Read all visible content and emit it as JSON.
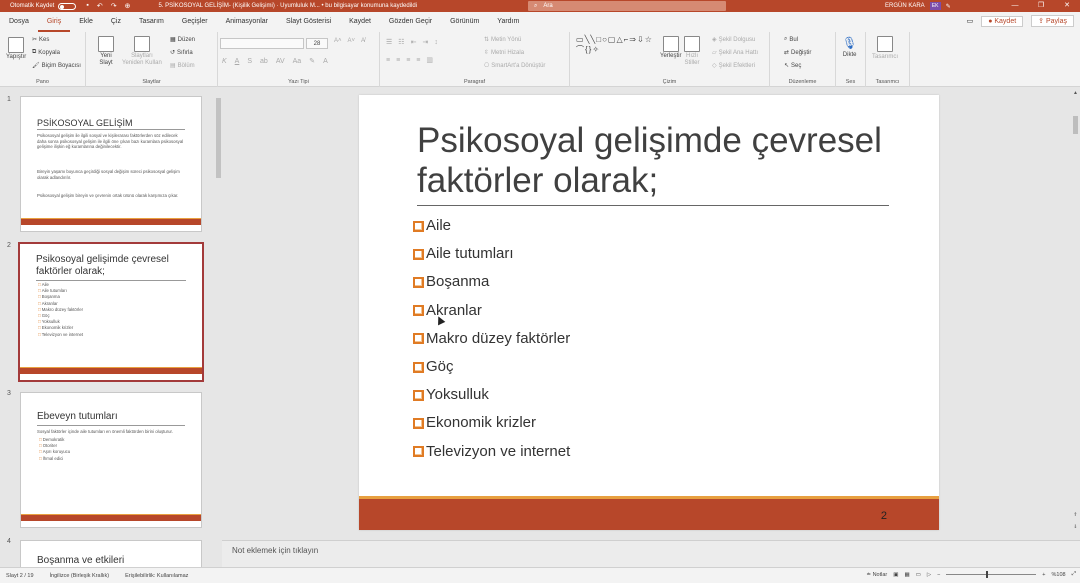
{
  "titlebar": {
    "autosave_label": "Otomatik Kaydet",
    "doc_title": "5. PSİKOSOYAL GELİŞİM- (Kişilik Gelişimi) · Uyumluluk M... • bu bilgisayar konumuna kaydedildi",
    "search_placeholder": "Ara",
    "user_name": "ERGÜN KARA",
    "user_initials": "EK",
    "qa_undo": "↶",
    "qa_redo": "↷",
    "qa_start": "⊕"
  },
  "menu": {
    "tabs": [
      "Dosya",
      "Giriş",
      "Ekle",
      "Çiz",
      "Tasarım",
      "Geçişler",
      "Animasyonlar",
      "Slayt Gösterisi",
      "Kaydet",
      "Gözden Geçir",
      "Görünüm",
      "Yardım"
    ],
    "active_tab": "Giriş",
    "record_btn": "Kaydet",
    "share_btn": "Paylaş"
  },
  "ribbon": {
    "pano": {
      "name": "Pano",
      "paste": "Yapıştır",
      "cut": "Kes",
      "copy": "Kopyala",
      "format_painter": "Biçim Boyacısı"
    },
    "slaytlar": {
      "name": "Slaytlar",
      "new_slide": "Yeni",
      "new_slide2": "Slayt",
      "reuse": "Slaytları",
      "reuse2": "Yeniden Kullan",
      "layout": "Düzen",
      "reset": "Sıfırla",
      "section": "Bölüm"
    },
    "yazi_tipi": {
      "name": "Yazı Tipi",
      "size": "28"
    },
    "paragraf": {
      "name": "Paragraf",
      "text_dir": "Metin Yönü",
      "align_text": "Metni Hizala",
      "smartart": "SmartArt'a Dönüştür"
    },
    "cizim": {
      "name": "Çizim",
      "arrange": "Yerleştir",
      "quick_styles": "Hızlı",
      "quick_styles2": "Stiller",
      "fill": "Şekil Dolgusu",
      "outline": "Şekil Ana Hattı",
      "effects": "Şekil Efektleri"
    },
    "duzenleme": {
      "name": "Düzenleme",
      "find": "Bul",
      "replace": "Değiştir",
      "select": "Seç"
    },
    "ses": {
      "name": "Ses",
      "dictate": "Dikte"
    },
    "tasarimci": {
      "name": "Tasarımcı",
      "label": "Tasarımcı"
    }
  },
  "thumbnails": [
    {
      "num": "1",
      "title": "PSİKOSOYAL GELİŞİM",
      "para1": "Psikososyal gelişim ile ilgili sosyal ve kişilerarası faktörlerden söz edilecek daha sonra psikososyal gelişim ile ilgili öne çıkan bazı kuramlara psikososyal gelişime ilişkin eğ kuramlarına değinilecektir.",
      "para2": "Bireyin yaşamı boyunca geçirdiği sosyal değişim süreci psikososyal gelişim olarak adlandırılır.",
      "para3": "Psikososyal gelişim bireyin ve çevrenin ortak ürünü olarak karşımıza çıkar."
    },
    {
      "num": "2",
      "title": "Psikosoyal gelişimde çevresel faktörler olarak;",
      "items": [
        "Aile",
        "Aile tutumları",
        "Boşanma",
        "Akranlar",
        "Makro düzey faktörler",
        "Göç",
        "Yoksulluk",
        "Ekonomik krizler",
        "Televizyon ve internet"
      ]
    },
    {
      "num": "3",
      "title": "Ebeveyn tutumları",
      "para1": "Sosyal faktörler içinde aile tutumları en önemli faktörden birini oluşturur.",
      "items": [
        "Demokratik",
        "Otoriter",
        "Aşırı koruyucu",
        "İhmal edici"
      ]
    },
    {
      "num": "4",
      "title": "Boşanma ve etkileri"
    }
  ],
  "slide": {
    "title": "Psikosoyal gelişimde çevresel faktörler olarak;",
    "bullets": [
      "Aile",
      "Aile tutumları",
      "Boşanma",
      "Akranlar",
      "Makro düzey faktörler",
      "Göç",
      "Yoksulluk",
      "Ekonomik krizler",
      "Televizyon ve internet"
    ],
    "page_number": "2"
  },
  "notes_placeholder": "Not eklemek için tıklayın",
  "status": {
    "slide_info": "Slayt 2 / 19",
    "language": "İngilizce (Birleşik Krallık)",
    "accessibility": "Erişilebilirlik: Kullanılamaz",
    "notes": "Notlar",
    "zoom": "%108"
  },
  "colors": {
    "accent": "#b7472a",
    "bullet": "#e07b24",
    "stripe": "#e8a040"
  }
}
